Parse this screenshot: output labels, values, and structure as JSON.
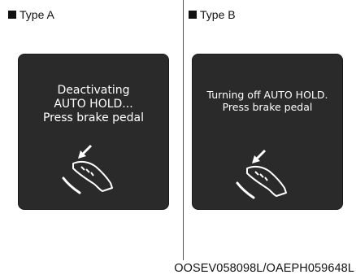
{
  "panels": [
    {
      "label": "Type A",
      "message_lines": [
        "Deactivating",
        "AUTO HOLD...",
        "Press brake pedal"
      ]
    },
    {
      "label": "Type B",
      "message_lines": [
        "Turning off AUTO HOLD.",
        "Press brake pedal"
      ]
    }
  ],
  "caption": "OOSEV058098L/OAEPH059648L",
  "colors": {
    "screen_background": "#2a2a2a",
    "screen_text": "#ffffff",
    "page_background": "#ffffff",
    "label_text": "#111111"
  },
  "icons": [
    "square-bullet-icon",
    "brake-pedal-foot-icon",
    "arrow-down-left-icon"
  ]
}
